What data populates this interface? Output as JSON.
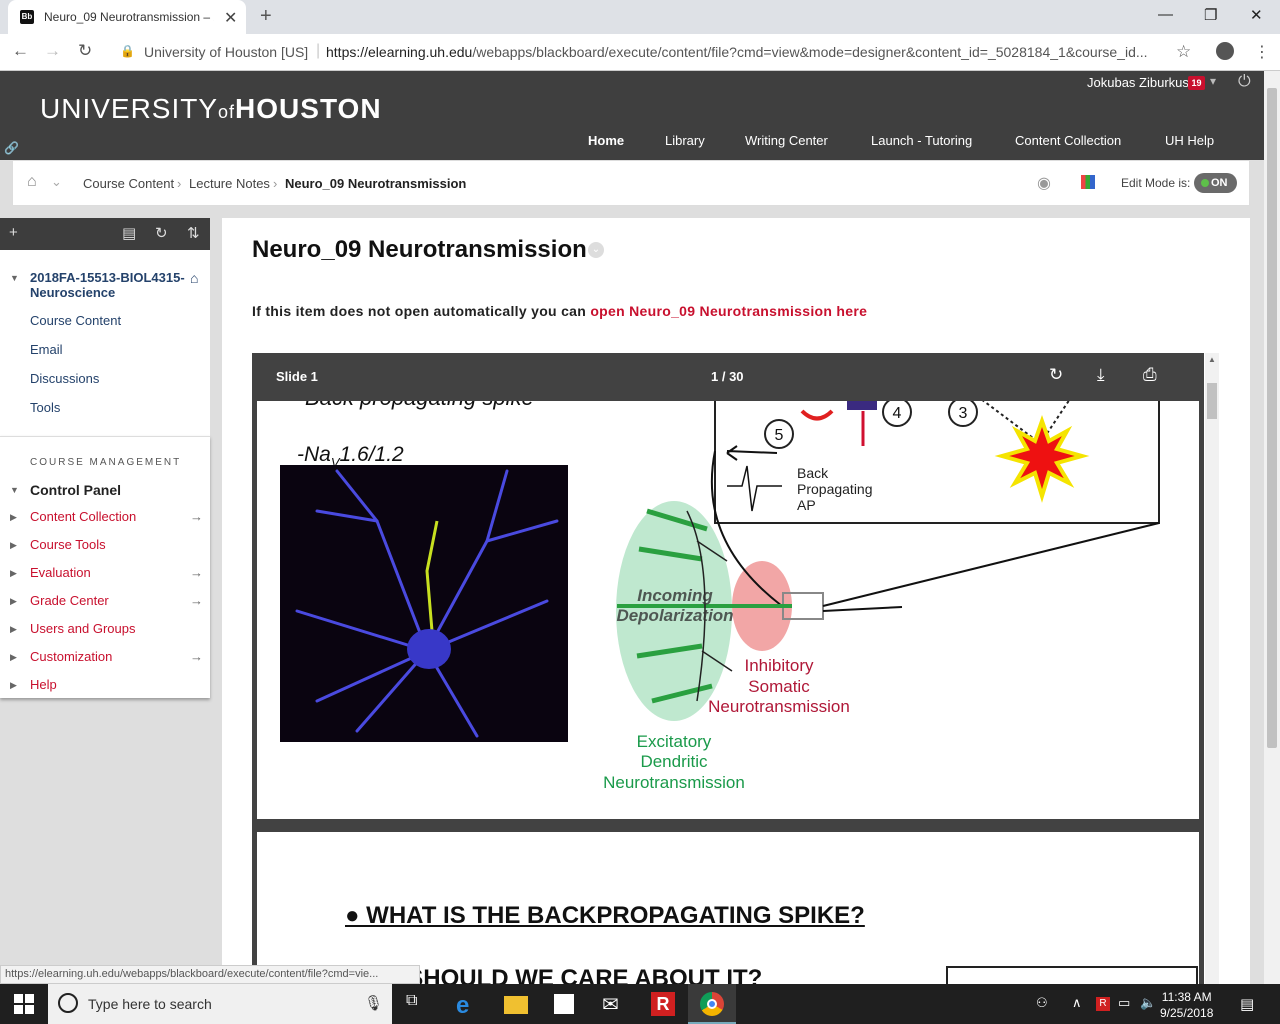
{
  "browser": {
    "tab_title": "Neuro_09 Neurotransmission – 2",
    "favicon_text": "Bb",
    "site_label": "University of Houston [US]",
    "url_host": "https://elearning.uh.edu",
    "url_path": "/webapps/blackboard/execute/content/file?cmd=view&mode=designer&content_id=_5028184_1&course_id...",
    "status_url": "https://elearning.uh.edu/webapps/blackboard/execute/content/file?cmd=vie..."
  },
  "header": {
    "logo_pre": "UNIVERSITY",
    "logo_of": "of",
    "logo_post": "HOUSTON",
    "user_name": "Jokubas Ziburkus",
    "notif_count": "19",
    "nav": [
      "Home",
      "Library",
      "Writing Center",
      "Launch - Tutoring",
      "Content Collection",
      "UH Help"
    ]
  },
  "breadcrumb": {
    "items": [
      "Course Content",
      "Lecture Notes",
      "Neuro_09 Neurotransmission"
    ],
    "edit_mode_label": "Edit Mode is:",
    "edit_mode_value": "ON"
  },
  "sidebar": {
    "course_title": "2018FA-15513-BIOL4315-Neuroscience",
    "course_links": [
      "Course Content",
      "Email",
      "Discussions",
      "Tools"
    ],
    "management_heading": "COURSE MANAGEMENT",
    "control_panel": "Control Panel",
    "control_items": [
      "Content Collection",
      "Course Tools",
      "Evaluation",
      "Grade Center",
      "Users and Groups",
      "Customization",
      "Help"
    ]
  },
  "content": {
    "title": "Neuro_09 Neurotransmission",
    "open_prefix": "If this item does not open automatically you can ",
    "open_link": "open Neuro_09 Neurotransmission here"
  },
  "viewer": {
    "slide_label": "Slide 1",
    "page_counter": "1  /  30",
    "slide1": {
      "top_text": "Back propagating spike",
      "nav_label": "-Na",
      "nav_sub": "V",
      "nav_suffix": "1.6/1.2",
      "num5": "5",
      "num4": "4",
      "num3": "3",
      "back_ap": [
        "Back",
        "Propagating",
        "AP"
      ],
      "incoming": [
        "Incoming",
        "Depolarization"
      ],
      "inhibitory": [
        "Inhibitory",
        "Somatic",
        "Neurotransmission"
      ],
      "excitatory": [
        "Excitatory",
        "Dendritic",
        "Neurotransmission"
      ]
    },
    "slide2": {
      "heading": "● WHAT IS THE BACKPROPAGATING SPIKE?",
      "subheading": "WHY SHOULD WE CARE ABOUT IT?"
    }
  },
  "taskbar": {
    "search_placeholder": "Type here to search",
    "time": "11:38 AM",
    "date": "9/25/2018"
  },
  "colors": {
    "brand_red": "#c8102e",
    "header_dark": "#3f3f3f",
    "link_blue": "#24426b"
  }
}
